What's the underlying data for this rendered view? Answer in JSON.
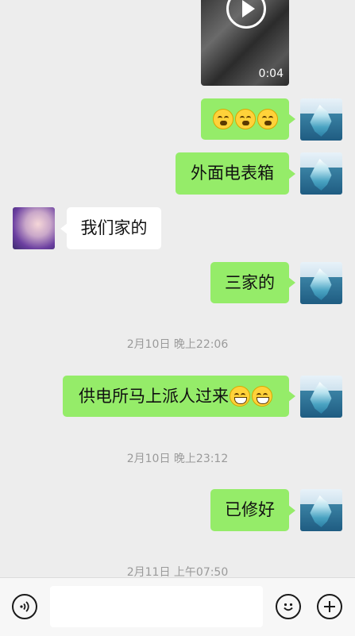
{
  "video": {
    "duration": "0:04"
  },
  "messages": {
    "m2": "外面电表箱",
    "m3": "我们家的",
    "m4": "三家的",
    "m5": "供电所马上派人过来",
    "m6": "已修好"
  },
  "timestamps": {
    "t1": "2月10日 晚上22:06",
    "t2": "2月10日 晚上23:12",
    "t3": "2月11日 上午07:50"
  },
  "input": {
    "placeholder": ""
  },
  "colors": {
    "my_bubble": "#95ec69",
    "their_bubble": "#ffffff",
    "background": "#ededed"
  }
}
